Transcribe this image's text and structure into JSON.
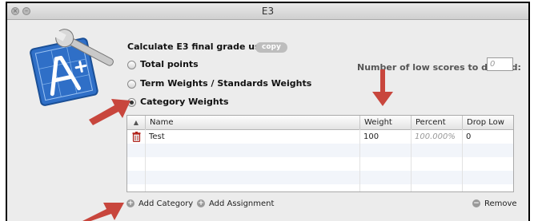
{
  "window": {
    "title": "E3"
  },
  "calc": {
    "label": "Calculate E3 final grade using:",
    "copy_label": "copy"
  },
  "options": [
    {
      "label": "Total points",
      "selected": false
    },
    {
      "label": "Term Weights / Standards Weights",
      "selected": false
    },
    {
      "label": "Category Weights",
      "selected": true
    }
  ],
  "low_scores": {
    "label": "Number of low scores to discard:",
    "placeholder": "0"
  },
  "table": {
    "sort_indicator": "▲",
    "columns": [
      "Name",
      "Weight",
      "Percent",
      "Drop Low"
    ],
    "rows": [
      {
        "name": "Test",
        "weight": "100",
        "percent": "100.000%",
        "drop_low": "0"
      }
    ]
  },
  "footer": {
    "add_category": "Add Category",
    "add_assignment": "Add Assignment",
    "remove": "Remove"
  },
  "colors": {
    "arrow": "#c8463d",
    "accent_blue": "#3a77c9"
  },
  "icons": [
    "close-icon",
    "minimize-icon",
    "app-icon",
    "delete-row-icon",
    "add-icon",
    "remove-icon",
    "annotation-arrow"
  ]
}
